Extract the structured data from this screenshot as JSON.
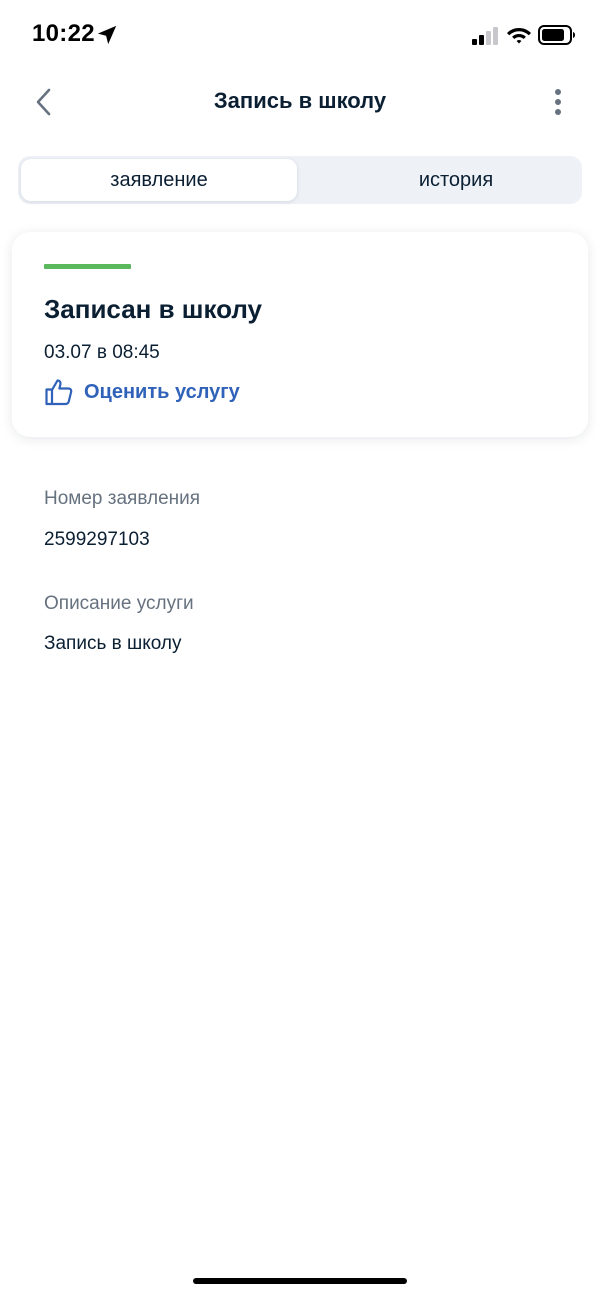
{
  "status_bar": {
    "time": "10:22",
    "icons": [
      "location-arrow-icon",
      "cellular-signal-icon",
      "wifi-icon",
      "battery-icon"
    ]
  },
  "header": {
    "title": "Запись в школу",
    "back_icon": "chevron-left-icon",
    "more_icon": "more-vertical-icon"
  },
  "tabs": [
    {
      "label": "заявление",
      "active": true
    },
    {
      "label": "история",
      "active": false
    }
  ],
  "status_card": {
    "status_color": "#5cb85c",
    "title": "Записан в школу",
    "date": "03.07 в 08:45",
    "rate_icon": "thumbs-up-icon",
    "rate_label": "Оценить услугу",
    "rate_color": "#2f62b8"
  },
  "details": [
    {
      "label": "Номер заявления",
      "value": "2599297103"
    },
    {
      "label": "Описание услуги",
      "value": "Запись в школу"
    }
  ]
}
